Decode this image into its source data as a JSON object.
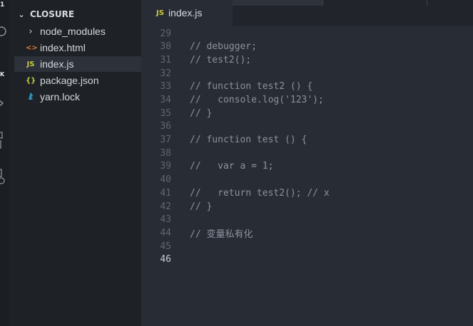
{
  "activity_bar": {
    "badge": "1",
    "label_fragment": "K"
  },
  "explorer": {
    "folder_name": "CLOSURE",
    "items": [
      {
        "label": "node_modules",
        "icon": "chevron-right-icon",
        "glyph": "›"
      },
      {
        "label": "index.html",
        "icon": "html-file-icon",
        "glyph": "<>"
      },
      {
        "label": "index.js",
        "icon": "js-file-icon",
        "glyph": "JS",
        "active": true
      },
      {
        "label": "package.json",
        "icon": "json-file-icon",
        "glyph": "{}"
      },
      {
        "label": "yarn.lock",
        "icon": "yarn-icon",
        "glyph": "🐈"
      }
    ]
  },
  "editor": {
    "tab": {
      "label": "index.js",
      "icon_glyph": "JS"
    },
    "current_line": "46",
    "lines": [
      {
        "n": "29",
        "text": ""
      },
      {
        "n": "30",
        "text": "// debugger;"
      },
      {
        "n": "31",
        "text": "// test2();"
      },
      {
        "n": "32",
        "text": ""
      },
      {
        "n": "33",
        "text": "// function test2 () {"
      },
      {
        "n": "34",
        "text": "//   console.log('123');"
      },
      {
        "n": "35",
        "text": "// }"
      },
      {
        "n": "36",
        "text": ""
      },
      {
        "n": "37",
        "text": "// function test () {"
      },
      {
        "n": "38",
        "text": ""
      },
      {
        "n": "39",
        "text": "//   var a = 1;"
      },
      {
        "n": "40",
        "text": ""
      },
      {
        "n": "41",
        "text": "//   return test2(); // x"
      },
      {
        "n": "42",
        "text": "// }"
      },
      {
        "n": "43",
        "text": ""
      },
      {
        "n": "44",
        "text": "// 变量私有化"
      },
      {
        "n": "45",
        "text": ""
      },
      {
        "n": "46",
        "text": ""
      }
    ]
  }
}
